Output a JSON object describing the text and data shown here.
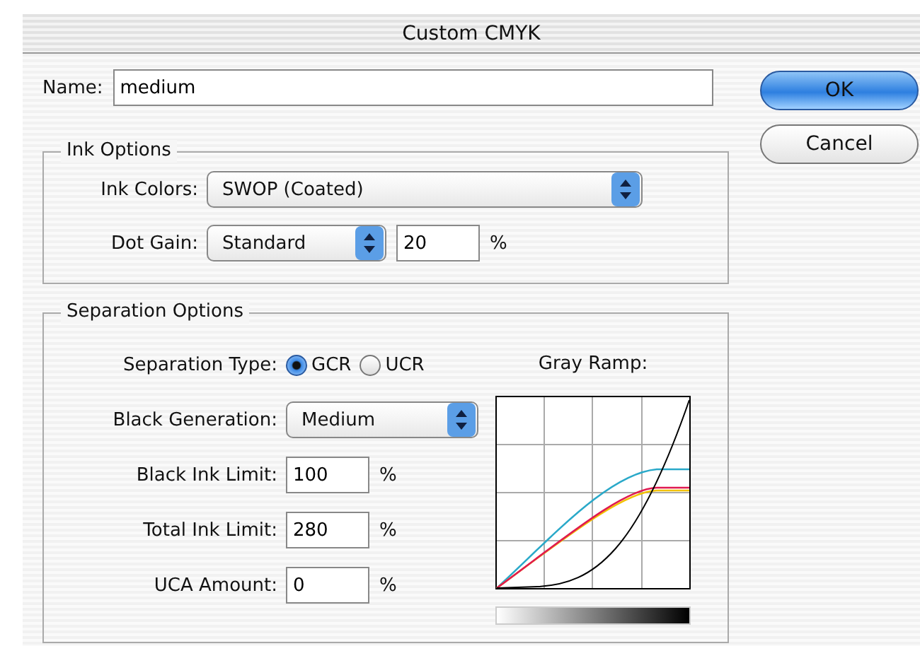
{
  "window": {
    "title": "Custom CMYK"
  },
  "name": {
    "label": "Name:",
    "value": "medium"
  },
  "buttons": [
    {
      "label": "OK",
      "default": true
    },
    {
      "label": "Cancel",
      "default": false
    }
  ],
  "ink_options": {
    "title": "Ink Options",
    "ink_colors": {
      "label": "Ink Colors:",
      "value": "SWOP (Coated)"
    },
    "dot_gain": {
      "label": "Dot Gain:",
      "value": "Standard",
      "amount": "20",
      "unit": "%"
    }
  },
  "separation_options": {
    "title": "Separation Options",
    "separation_type": {
      "label": "Separation Type:",
      "options": [
        {
          "label": "GCR",
          "selected": true
        },
        {
          "label": "UCR",
          "selected": false
        }
      ]
    },
    "gray_ramp": {
      "label": "Gray Ramp:"
    },
    "black_generation": {
      "label": "Black Generation:",
      "value": "Medium"
    },
    "limits": [
      {
        "label": "Black Ink Limit:",
        "value": "100",
        "unit": "%"
      },
      {
        "label": "Total Ink Limit:",
        "value": "280",
        "unit": "%"
      },
      {
        "label": "UCA Amount:",
        "value": "0",
        "unit": "%"
      }
    ]
  }
}
